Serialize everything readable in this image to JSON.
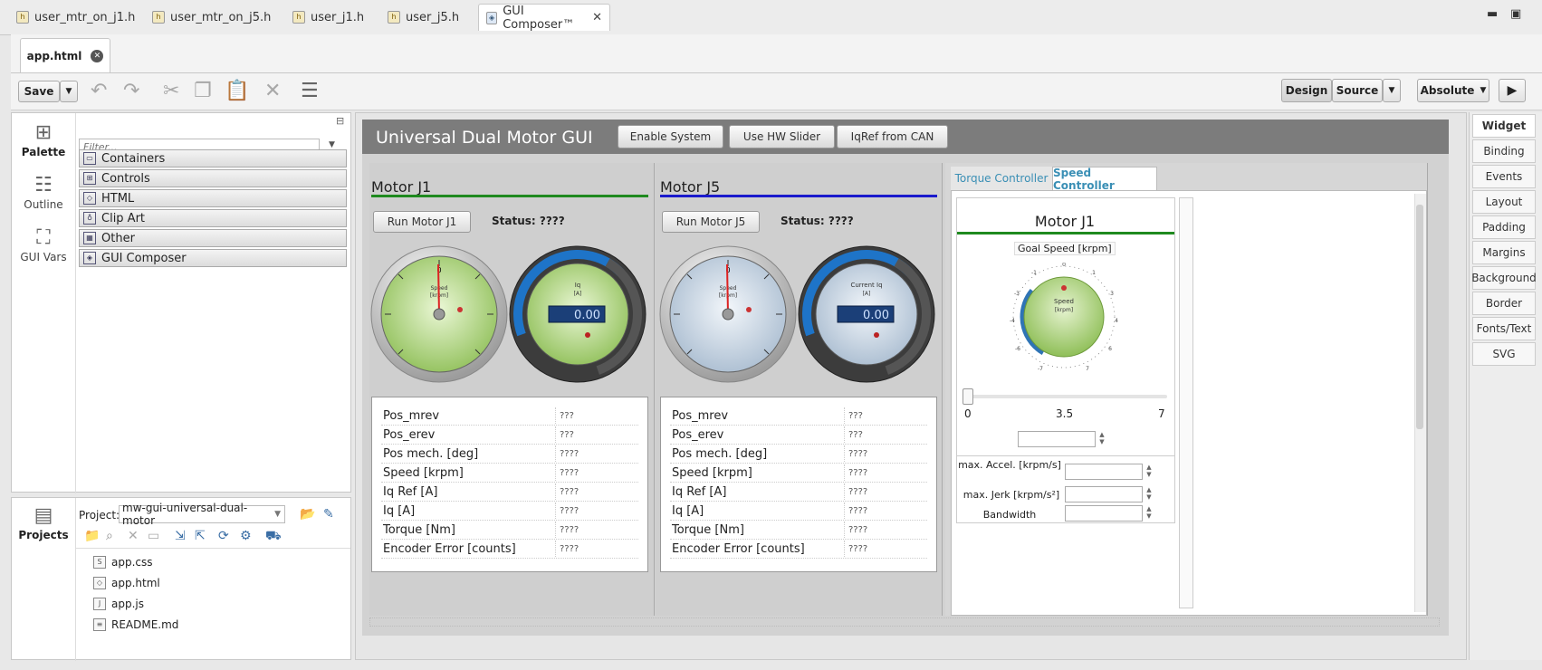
{
  "editor_tabs": [
    {
      "label": "user_mtr_on_j1.h"
    },
    {
      "label": "user_mtr_on_j5.h"
    },
    {
      "label": "user_j1.h"
    },
    {
      "label": "user_j5.h"
    },
    {
      "label": "GUI Composer™"
    }
  ],
  "window": {
    "minimize": "▬",
    "maximize": "▣"
  },
  "file_tab": {
    "label": "app.html"
  },
  "toolbar": {
    "save_label": "Save",
    "design_label": "Design",
    "source_label": "Source",
    "absolute_label": "Absolute"
  },
  "palette": {
    "tabs": [
      "Palette",
      "Outline",
      "GUI Vars"
    ],
    "filter_placeholder": "Filter...",
    "categories": [
      "Containers",
      "Controls",
      "HTML",
      "Clip Art",
      "Other",
      "GUI Composer"
    ]
  },
  "projects": {
    "tab_label": "Projects",
    "project_label": "Project:",
    "project_value": "mw-gui-universal-dual-motor",
    "files": [
      "app.css",
      "app.html",
      "app.js",
      "README.md"
    ]
  },
  "gui": {
    "title": "Universal Dual Motor GUI",
    "header_buttons": [
      "Enable System",
      "Use HW Slider",
      "IqRef from CAN"
    ],
    "motors": [
      {
        "title": "Motor J1",
        "line_color": "#1f8a1f",
        "run_label": "Run Motor J1",
        "status": "Status: ????",
        "gauge1_label": "Speed",
        "gauge1_unit": "[krpm]",
        "gauge2_label": "Iq",
        "gauge2_unit": "[A]",
        "gauge2_value": "0.00",
        "rows": [
          {
            "label": "Pos_mrev",
            "value": "???"
          },
          {
            "label": "Pos_erev",
            "value": "???"
          },
          {
            "label": "Pos mech. [deg]",
            "value": "????"
          },
          {
            "label": "Speed [krpm]",
            "value": "????"
          },
          {
            "label": "Iq Ref [A]",
            "value": "????"
          },
          {
            "label": "Iq [A]",
            "value": "????"
          },
          {
            "label": "Torque [Nm]",
            "value": "????"
          },
          {
            "label": "Encoder Error [counts]",
            "value": "????"
          }
        ]
      },
      {
        "title": "Motor J5",
        "line_color": "#1a1acc",
        "run_label": "Run Motor J5",
        "status": "Status: ????",
        "gauge1_label": "Speed",
        "gauge1_unit": "[krpm]",
        "gauge2_label": "Current Iq",
        "gauge2_unit": "[A]",
        "gauge2_value": "0.00",
        "rows": [
          {
            "label": "Pos_mrev",
            "value": "???"
          },
          {
            "label": "Pos_erev",
            "value": "???"
          },
          {
            "label": "Pos mech. [deg]",
            "value": "????"
          },
          {
            "label": "Speed [krpm]",
            "value": "????"
          },
          {
            "label": "Iq Ref [A]",
            "value": "????"
          },
          {
            "label": "Iq [A]",
            "value": "????"
          },
          {
            "label": "Torque [Nm]",
            "value": "????"
          },
          {
            "label": "Encoder Error [counts]",
            "value": "????"
          }
        ]
      }
    ],
    "controller_tabs": [
      "Torque Controller",
      "Speed Controller"
    ],
    "speed": {
      "title": "Motor J1",
      "goal_label": "Goal Speed [krpm]",
      "knob_label": "Speed",
      "knob_unit": "[krpm]",
      "slider_min": "0",
      "slider_mid": "3.5",
      "slider_max": "7",
      "slider_value": 0,
      "params": [
        "max. Accel. [krpm/s]",
        "max. Jerk [krpm/s²]",
        "Bandwidth"
      ]
    }
  },
  "property_tabs": [
    "Widget",
    "Binding",
    "Events",
    "Layout",
    "Padding",
    "Margins",
    "Background",
    "Border",
    "Fonts/Text",
    "SVG"
  ]
}
